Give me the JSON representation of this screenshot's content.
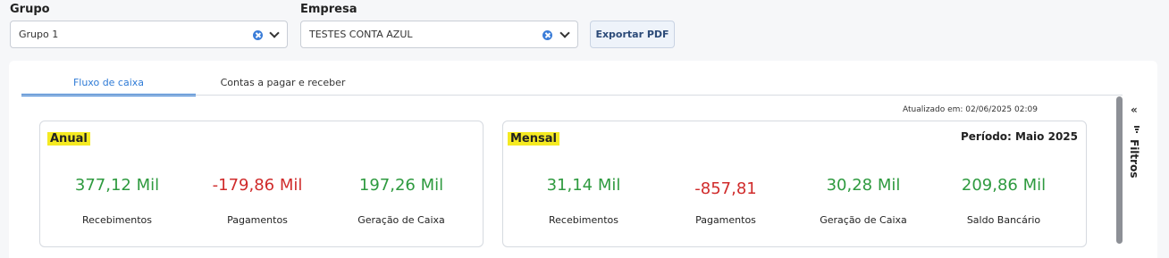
{
  "filters": {
    "grupo": {
      "label": "Grupo",
      "value": "Grupo 1"
    },
    "empresa": {
      "label": "Empresa",
      "value": "TESTES CONTA AZUL"
    },
    "export_label": "Exportar PDF"
  },
  "tabs": [
    {
      "label": "Fluxo de caixa",
      "active": true
    },
    {
      "label": "Contas a pagar e receber",
      "active": false
    }
  ],
  "updated_text": "Atualizado em: 02/06/2025 02:09",
  "annual": {
    "title": "Anual",
    "metrics": [
      {
        "value": "377,12 Mil",
        "label": "Recebimentos",
        "status": "positive"
      },
      {
        "value": "-179,86 Mil",
        "label": "Pagamentos",
        "status": "negative"
      },
      {
        "value": "197,26 Mil",
        "label": "Geração de Caixa",
        "status": "positive"
      }
    ]
  },
  "monthly": {
    "title": "Mensal",
    "period": "Período: Maio 2025",
    "metrics": [
      {
        "value": "31,14 Mil",
        "label": "Recebimentos",
        "status": "positive"
      },
      {
        "value": "-857,81",
        "label": "Pagamentos",
        "status": "negative"
      },
      {
        "value": "30,28 Mil",
        "label": "Geração de Caixa",
        "status": "positive"
      },
      {
        "value": "209,86 Mil",
        "label": "Saldo Bancário",
        "status": "positive"
      }
    ]
  },
  "side_panel": {
    "label": "Filtros",
    "collapse_icon": "double-chevron-left-icon",
    "filter_icon": "filter-icon"
  },
  "colors": {
    "accent": "#2f7bd6",
    "positive": "#2e9a3f",
    "negative": "#d02b2b",
    "highlight": "#f5ea22"
  }
}
